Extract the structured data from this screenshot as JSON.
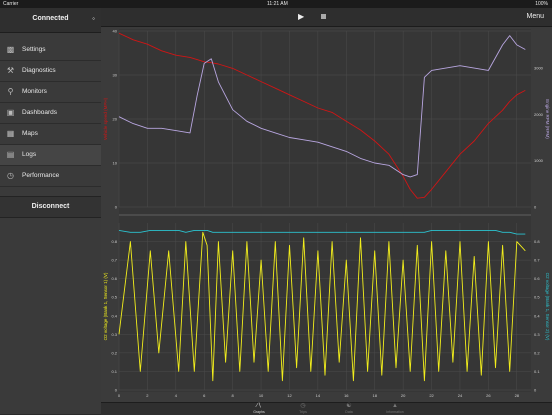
{
  "status": {
    "carrier": "Carrier",
    "time": "11:21 AM",
    "battery": "100%"
  },
  "sidebar": {
    "connection": "Connected",
    "items": [
      {
        "label": "Settings"
      },
      {
        "label": "Diagnostics"
      },
      {
        "label": "Monitors"
      },
      {
        "label": "Dashboards"
      },
      {
        "label": "Maps"
      },
      {
        "label": "Logs"
      },
      {
        "label": "Performance"
      }
    ],
    "disconnect": "Disconnect"
  },
  "toolbar": {
    "menu": "Menu"
  },
  "tabs": [
    {
      "label": "Graphs"
    },
    {
      "label": "Trips"
    },
    {
      "label": "Data"
    },
    {
      "label": "Information"
    }
  ],
  "colors": {
    "speed": "#d01515",
    "rpm": "#b8a6e0",
    "o2s1": "#f2ee1c",
    "o2s2": "#2bc3d0"
  },
  "chart_data": [
    {
      "type": "line",
      "x": [
        0,
        1,
        2,
        3,
        4,
        5,
        5.5,
        6,
        6.5,
        7,
        8,
        9,
        10,
        11,
        12,
        13,
        14,
        15,
        16,
        17,
        18,
        19,
        20,
        20.5,
        21,
        21.5,
        22,
        23,
        24,
        25,
        26,
        27,
        27.5,
        28,
        28.6
      ],
      "xlim": [
        0,
        29
      ],
      "ylabel": "Vehicle speed (MPH)",
      "y2label": "Engine RPM (RPM)",
      "yticks": [
        "0",
        "10",
        "20",
        "30",
        "40"
      ],
      "ylim": [
        0,
        40
      ],
      "y2ticks": [
        "0",
        "1000",
        "2000",
        "3000"
      ],
      "y2lim": [
        0,
        3800
      ],
      "series": [
        {
          "name": "Vehicle speed (MPH)",
          "axis": "left",
          "values": [
            39.5,
            38,
            37,
            35.5,
            34.5,
            34,
            33.5,
            33,
            32.8,
            32.5,
            31.5,
            30,
            28.5,
            27,
            25.5,
            24,
            22.5,
            21.5,
            19.5,
            17.5,
            15,
            12,
            7,
            4,
            2,
            2.2,
            4,
            8,
            12,
            15,
            19,
            22,
            24,
            25.5,
            26.5
          ]
        },
        {
          "name": "Engine RPM (RPM)",
          "axis": "right",
          "values": [
            1950,
            1800,
            1700,
            1700,
            1650,
            1600,
            2400,
            3100,
            3200,
            2700,
            2100,
            1850,
            1700,
            1600,
            1500,
            1450,
            1400,
            1300,
            1200,
            1050,
            950,
            900,
            700,
            650,
            700,
            2800,
            2950,
            3000,
            3050,
            3000,
            2950,
            3500,
            3700,
            3500,
            3400
          ]
        }
      ]
    },
    {
      "type": "line",
      "x": [
        0,
        0.8,
        1.5,
        2.2,
        2.8,
        3.5,
        4.2,
        4.7,
        5.3,
        5.9,
        6.2,
        6.6,
        7,
        7.5,
        8,
        8.5,
        9,
        9.5,
        10,
        10.5,
        11,
        11.5,
        12,
        12.5,
        13,
        13.5,
        14,
        14.5,
        15,
        15.5,
        16,
        16.5,
        17,
        17.5,
        18,
        18.5,
        19,
        19.5,
        20,
        20.5,
        21,
        21.5,
        22,
        22.5,
        23,
        23.5,
        24,
        24.5,
        25,
        25.5,
        26,
        26.5,
        27,
        27.5,
        28,
        28.6
      ],
      "xlim": [
        0,
        29
      ],
      "xticks": [
        "0",
        "2",
        "4",
        "6",
        "8",
        "10",
        "12",
        "14",
        "16",
        "18",
        "20",
        "22",
        "24",
        "26",
        "28"
      ],
      "ylabel": "O2 voltage (Bank 1, Sensor 1) (V)",
      "y2label": "O2 voltage (Bank 1, Sensor 2) (V)",
      "yticks": [
        "0",
        "0.1",
        "0.2",
        "0.3",
        "0.4",
        "0.5",
        "0.6",
        "0.7",
        "0.8"
      ],
      "ylim": [
        0,
        0.9
      ],
      "y2ticks": [
        "0",
        "0.1",
        "0.2",
        "0.3",
        "0.4",
        "0.5",
        "0.6",
        "0.7",
        "0.8"
      ],
      "y2lim": [
        0,
        0.9
      ],
      "series": [
        {
          "name": "O2 voltage (Bank 1, Sensor 1) (V)",
          "axis": "left",
          "values": [
            0.3,
            0.8,
            0.1,
            0.75,
            0.2,
            0.75,
            0.1,
            0.8,
            0.1,
            0.85,
            0.78,
            0.05,
            0.8,
            0.15,
            0.75,
            0.1,
            0.8,
            0.15,
            0.7,
            0.1,
            0.8,
            0.05,
            0.78,
            0.12,
            0.82,
            0.1,
            0.75,
            0.08,
            0.8,
            0.15,
            0.7,
            0.05,
            0.82,
            0.1,
            0.75,
            0.08,
            0.8,
            0.12,
            0.7,
            0.1,
            0.78,
            0.05,
            0.8,
            0.1,
            0.75,
            0.15,
            0.8,
            0.1,
            0.72,
            0.08,
            0.8,
            0.12,
            0.78,
            0.1,
            0.8,
            0.75
          ]
        },
        {
          "name": "O2 voltage (Bank 1, Sensor 2) (V)",
          "axis": "right",
          "values": [
            0.86,
            0.85,
            0.85,
            0.86,
            0.86,
            0.86,
            0.86,
            0.85,
            0.86,
            0.86,
            0.86,
            0.85,
            0.85,
            0.85,
            0.85,
            0.85,
            0.85,
            0.85,
            0.85,
            0.85,
            0.85,
            0.85,
            0.85,
            0.85,
            0.85,
            0.85,
            0.85,
            0.85,
            0.85,
            0.85,
            0.85,
            0.85,
            0.85,
            0.85,
            0.85,
            0.85,
            0.85,
            0.85,
            0.85,
            0.85,
            0.85,
            0.85,
            0.86,
            0.86,
            0.86,
            0.86,
            0.86,
            0.86,
            0.86,
            0.86,
            0.86,
            0.86,
            0.85,
            0.85,
            0.84,
            0.84
          ]
        }
      ]
    }
  ]
}
